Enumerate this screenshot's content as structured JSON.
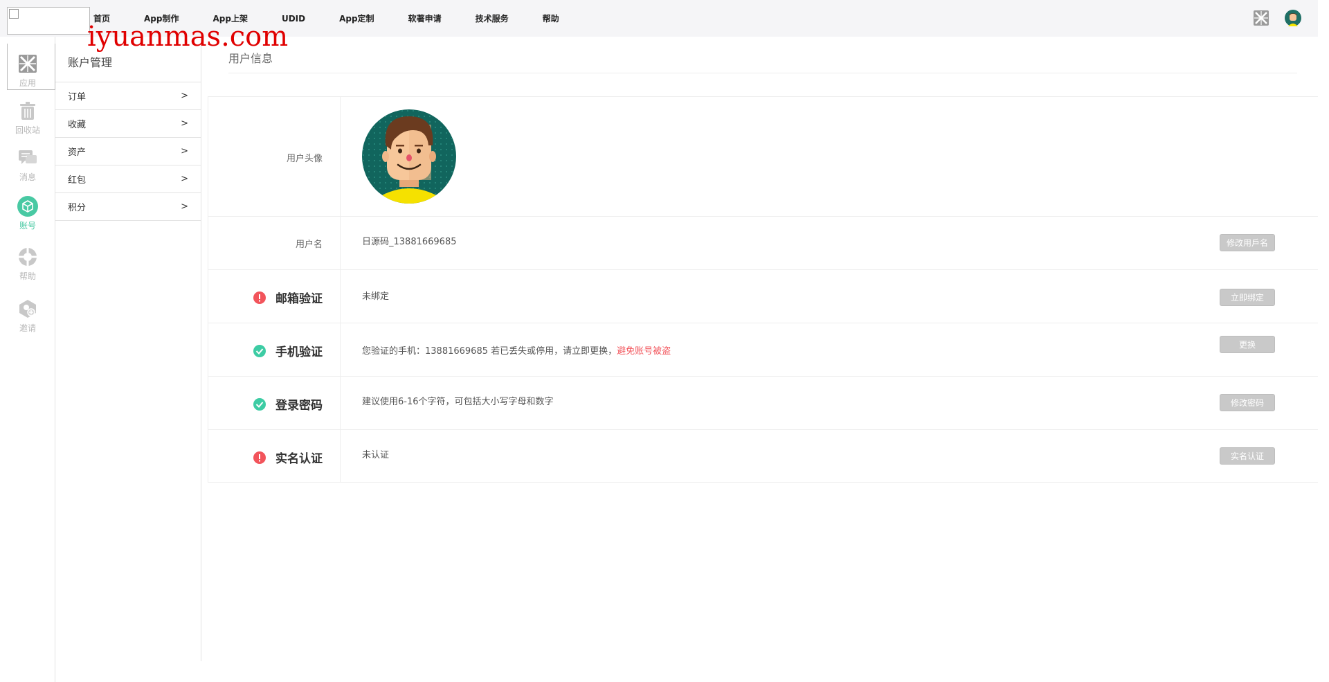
{
  "watermark": "iyuanmas.com",
  "nav": {
    "items": [
      "首页",
      "App制作",
      "App上架",
      "UDID",
      "App定制",
      "软著申请",
      "技术服务",
      "帮助"
    ]
  },
  "rail": {
    "items": [
      {
        "label": "应用",
        "icon": "apps-icon"
      },
      {
        "label": "回收站",
        "icon": "trash-icon"
      },
      {
        "label": "消息",
        "icon": "message-icon"
      },
      {
        "label": "账号",
        "icon": "account-cube-icon",
        "active": true
      },
      {
        "label": "帮助",
        "icon": "lifebuoy-icon"
      },
      {
        "label": "邀请",
        "icon": "invite-icon"
      }
    ]
  },
  "submenu": {
    "title": "账户管理",
    "items": [
      {
        "label": "订单",
        "arrow": ">"
      },
      {
        "label": "收藏",
        "arrow": ">"
      },
      {
        "label": "资产",
        "arrow": ">"
      },
      {
        "label": "红包",
        "arrow": ">"
      },
      {
        "label": "积分",
        "arrow": ">"
      }
    ]
  },
  "content": {
    "title": "用户信息",
    "avatar_label": "用户头像",
    "username": {
      "label": "用户名",
      "value": "日源码_13881669685",
      "button": "修改用戶名"
    },
    "email": {
      "label": "邮箱验证",
      "value": "未绑定",
      "button": "立即绑定",
      "status": "warning"
    },
    "phone": {
      "label": "手机验证",
      "value": "您验证的手机：13881669685 若已丢失或停用，请立即更换，",
      "value_warning": "避免账号被盗",
      "button": "更换",
      "status": "ok"
    },
    "password": {
      "label": "登录密码",
      "value": "建议使用6-16个字符，可包括大小写字母和数字",
      "button": "修改密码",
      "status": "ok"
    },
    "realname": {
      "label": "实名认证",
      "value": "未认证",
      "button": "实名认证",
      "status": "warning"
    }
  },
  "colors": {
    "accent": "#48c9a3",
    "danger": "#f2545b",
    "button_disabled": "#c9c9c9"
  }
}
